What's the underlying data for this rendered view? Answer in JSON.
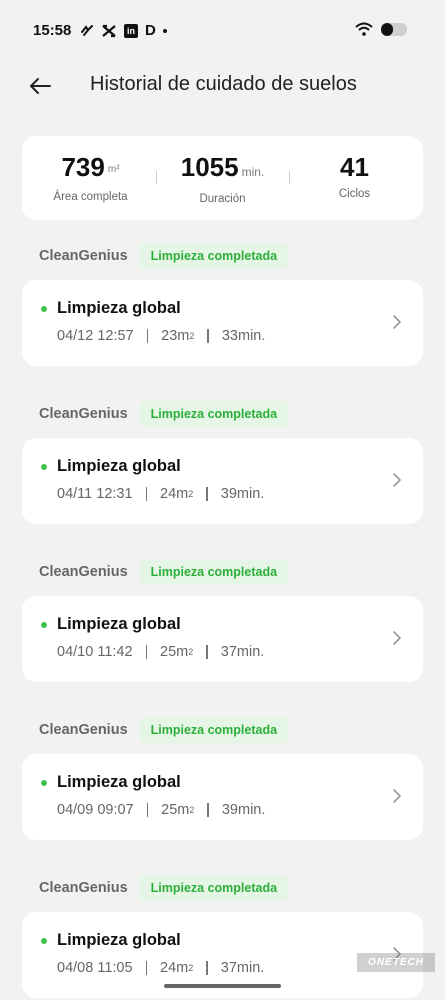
{
  "status_bar": {
    "time": "15:58",
    "apps": [
      "app-icon-1",
      "capcut-icon",
      "linkedin-icon",
      "app-d-icon",
      "more-dot-icon"
    ],
    "linkedin": "in",
    "d_app": "D",
    "battery_level": 0.45
  },
  "header": {
    "back_icon": "arrow-left-icon",
    "title": "Historial de cuidado de suelos"
  },
  "summary": {
    "area": {
      "value": "739",
      "unit": "m²",
      "label": "Área completa"
    },
    "duration": {
      "value": "1055",
      "unit": "min.",
      "label": "Duración"
    },
    "cycles": {
      "value": "41",
      "label": "Ciclos"
    }
  },
  "records": [
    {
      "source": "CleanGenius",
      "status": "Limpieza completada",
      "title": "Limpieza global",
      "date": "04/12",
      "time": "12:57",
      "area": "23m",
      "duration": "33min."
    },
    {
      "source": "CleanGenius",
      "status": "Limpieza completada",
      "title": "Limpieza global",
      "date": "04/11",
      "time": "12:31",
      "area": "24m",
      "duration": "39min."
    },
    {
      "source": "CleanGenius",
      "status": "Limpieza completada",
      "title": "Limpieza global",
      "date": "04/10",
      "time": "11:42",
      "area": "25m",
      "duration": "37min."
    },
    {
      "source": "CleanGenius",
      "status": "Limpieza completada",
      "title": "Limpieza global",
      "date": "04/09",
      "time": "09:07",
      "area": "25m",
      "duration": "39min."
    },
    {
      "source": "CleanGenius",
      "status": "Limpieza completada",
      "title": "Limpieza global",
      "date": "04/08",
      "time": "11:05",
      "area": "24m",
      "duration": "37min."
    }
  ],
  "area_superscript": "2",
  "watermark": "ONETECH",
  "colors": {
    "accent_green": "#3cc24a",
    "badge_bg": "#e6f6e6",
    "badge_text": "#2cae3a",
    "background": "#f2f2f2"
  }
}
